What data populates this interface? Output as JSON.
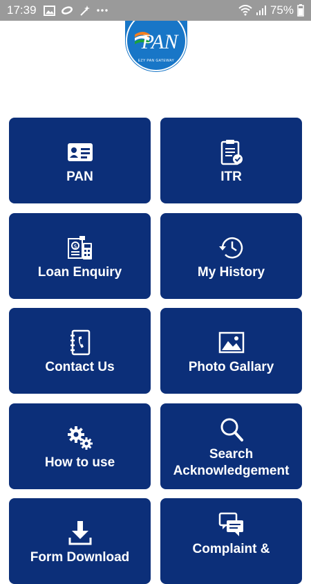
{
  "status_bar": {
    "time": "17:39",
    "battery": "75%",
    "icons": [
      "image-icon",
      "link-icon",
      "magic-wand-icon",
      "more-icon",
      "wifi-icon",
      "signal-icon",
      "battery-icon"
    ]
  },
  "logo": {
    "text": "PAN",
    "subtext": "EZY PAN GATEWAY"
  },
  "tiles": [
    {
      "label": "PAN",
      "icon": "id-card-icon"
    },
    {
      "label": "ITR",
      "icon": "clipboard-check-icon"
    },
    {
      "label": "Loan Enquiry",
      "icon": "loan-calculator-icon"
    },
    {
      "label": "My History",
      "icon": "history-clock-icon"
    },
    {
      "label": "Contact Us",
      "icon": "address-book-icon"
    },
    {
      "label": "Photo Gallary",
      "icon": "photo-icon"
    },
    {
      "label": "How to use",
      "icon": "gears-icon"
    },
    {
      "label": "Search\nAcknowledgement",
      "icon": "search-icon"
    },
    {
      "label": "Form Download",
      "icon": "download-icon"
    },
    {
      "label": "Complaint &",
      "icon": "chat-bubbles-icon"
    }
  ],
  "colors": {
    "tile_bg": "#0c2f79",
    "status_bar_bg": "#9a9a9a",
    "logo_bg": "#1876c7"
  }
}
